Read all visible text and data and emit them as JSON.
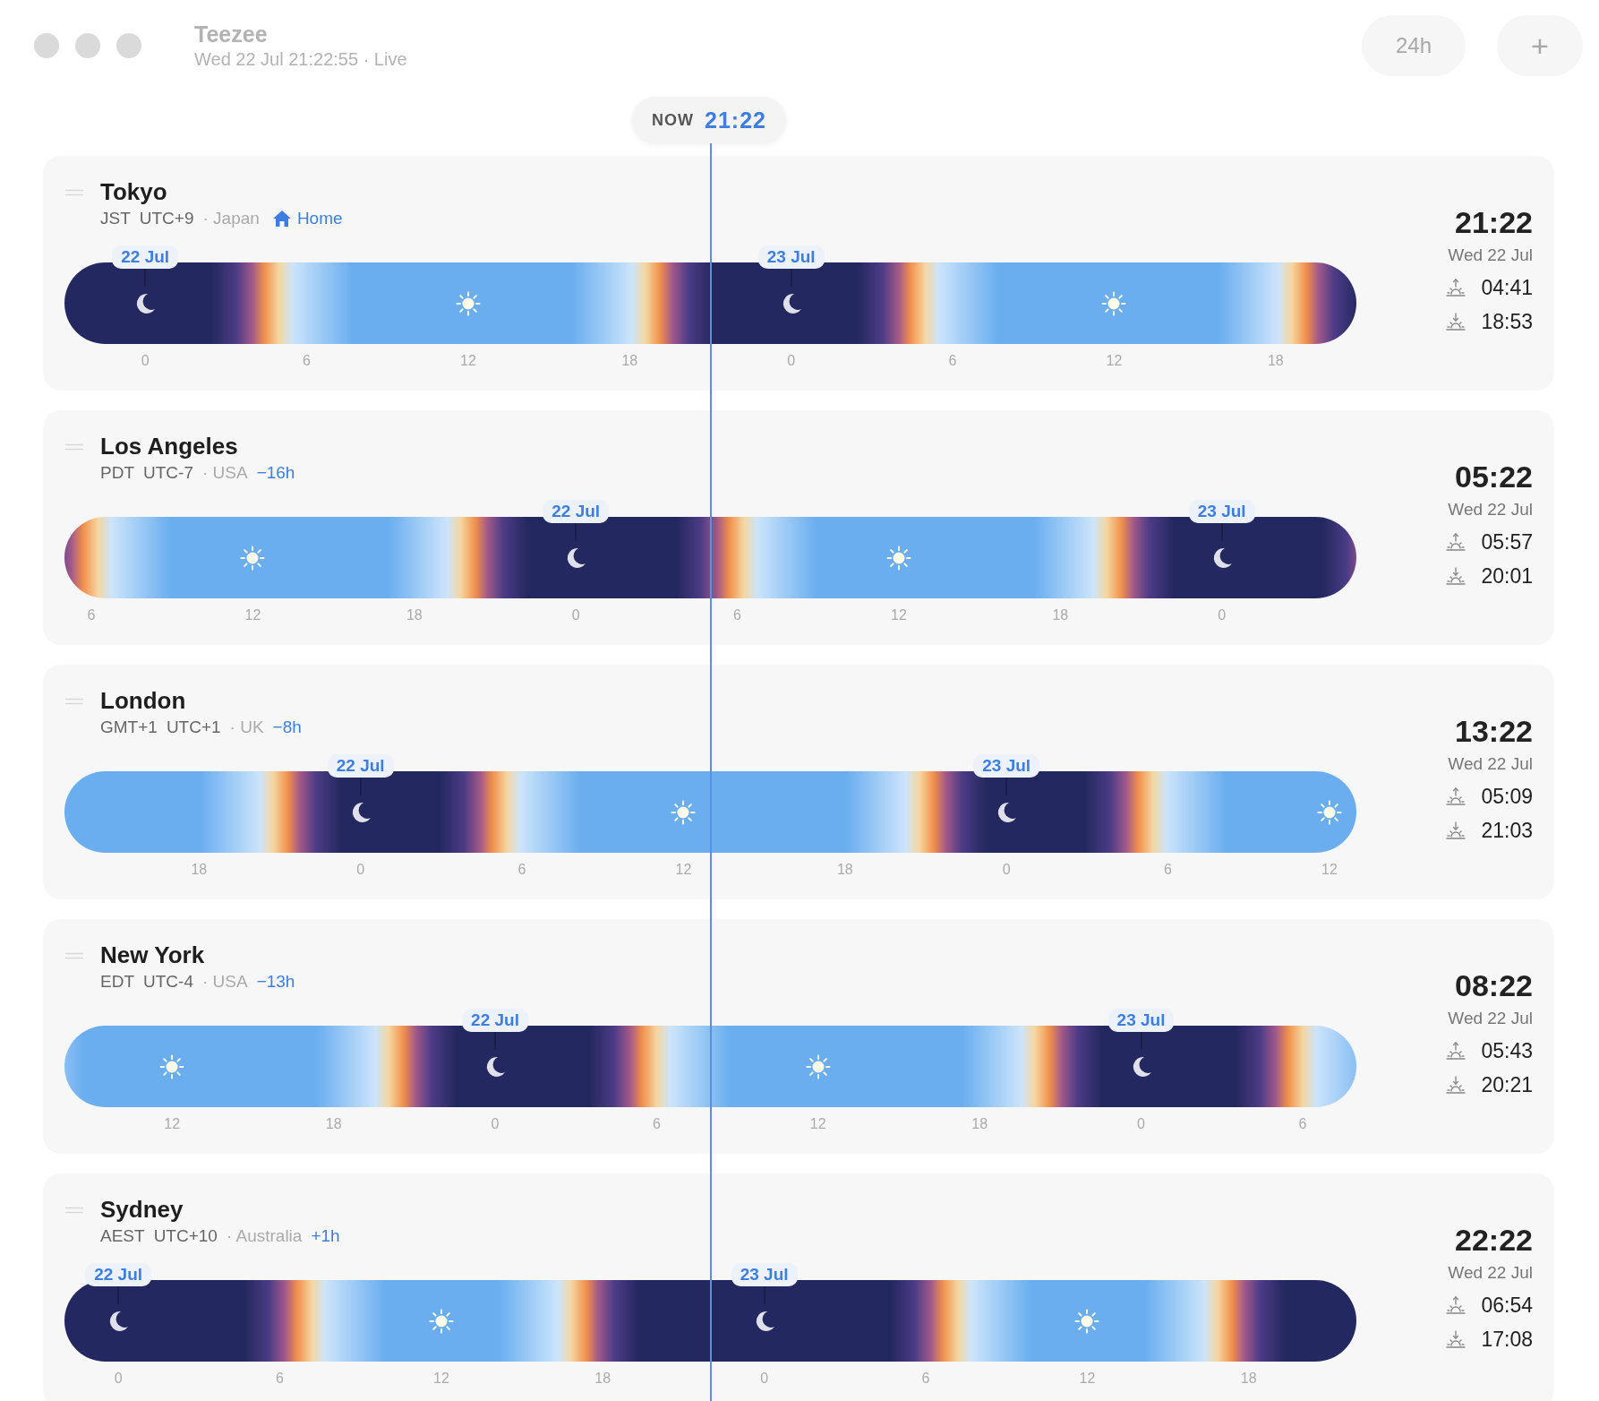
{
  "app": {
    "title": "Teezee",
    "subtitle": "Wed 22 Jul 21:22:55 · Live"
  },
  "toolbar": {
    "buttons": [
      "24h",
      "+"
    ]
  },
  "now_marker": {
    "label": "NOW",
    "time": "21:22"
  },
  "cities": [
    {
      "name": "Tokyo",
      "abbr": "JST",
      "utc": "UTC+9",
      "country": "· Japan",
      "badge": {
        "kind": "home",
        "text": "Home"
      },
      "time": "21:22",
      "date": "Wed 22 Jul",
      "sunrise": "04:41",
      "sunset": "18:53",
      "ticks": [
        {
          "label": "0",
          "kind": "midnight",
          "date": "22 Jul"
        },
        {
          "label": "6",
          "kind": "dawn"
        },
        {
          "label": "12",
          "kind": "noon"
        },
        {
          "label": "18",
          "kind": "dusk"
        },
        {
          "label": "0",
          "kind": "midnight",
          "date": "23 Jul"
        },
        {
          "label": "6",
          "kind": "dawn"
        },
        {
          "label": "12",
          "kind": "noon"
        },
        {
          "label": "18",
          "kind": "dusk"
        }
      ]
    },
    {
      "name": "Los Angeles",
      "abbr": "PDT",
      "utc": "UTC-7",
      "country": "· USA",
      "badge": {
        "kind": "offset",
        "text": "−16h"
      },
      "time": "05:22",
      "date": "Wed 22 Jul",
      "sunrise": "05:57",
      "sunset": "20:01",
      "ticks": [
        {
          "label": "6",
          "kind": "dawn"
        },
        {
          "label": "12",
          "kind": "noon"
        },
        {
          "label": "18",
          "kind": "dusk"
        },
        {
          "label": "0",
          "kind": "midnight",
          "date": "22 Jul"
        },
        {
          "label": "6",
          "kind": "dawn"
        },
        {
          "label": "12",
          "kind": "noon"
        },
        {
          "label": "18",
          "kind": "dusk"
        },
        {
          "label": "0",
          "kind": "midnight",
          "date": "23 Jul"
        }
      ]
    },
    {
      "name": "London",
      "abbr": "GMT+1",
      "utc": "UTC+1",
      "country": "· UK",
      "badge": {
        "kind": "offset",
        "text": "−8h"
      },
      "time": "13:22",
      "date": "Wed 22 Jul",
      "sunrise": "05:09",
      "sunset": "21:03",
      "ticks": [
        {
          "label": "18",
          "kind": "dusk"
        },
        {
          "label": "0",
          "kind": "midnight",
          "date": "22 Jul"
        },
        {
          "label": "6",
          "kind": "dawn"
        },
        {
          "label": "12",
          "kind": "noon"
        },
        {
          "label": "18",
          "kind": "dusk"
        },
        {
          "label": "0",
          "kind": "midnight",
          "date": "23 Jul"
        },
        {
          "label": "6",
          "kind": "dawn"
        },
        {
          "label": "12",
          "kind": "noon"
        }
      ]
    },
    {
      "name": "New York",
      "abbr": "EDT",
      "utc": "UTC-4",
      "country": "· USA",
      "badge": {
        "kind": "offset",
        "text": "−13h"
      },
      "time": "08:22",
      "date": "Wed 22 Jul",
      "sunrise": "05:43",
      "sunset": "20:21",
      "ticks": [
        {
          "label": "12",
          "kind": "noon"
        },
        {
          "label": "18",
          "kind": "dusk"
        },
        {
          "label": "0",
          "kind": "midnight",
          "date": "22 Jul"
        },
        {
          "label": "6",
          "kind": "dawn"
        },
        {
          "label": "12",
          "kind": "noon"
        },
        {
          "label": "18",
          "kind": "dusk"
        },
        {
          "label": "0",
          "kind": "midnight",
          "date": "23 Jul"
        },
        {
          "label": "6",
          "kind": "dawn"
        }
      ]
    },
    {
      "name": "Sydney",
      "abbr": "AEST",
      "utc": "UTC+10",
      "country": "· Australia",
      "badge": {
        "kind": "offset",
        "text": "+1h"
      },
      "time": "22:22",
      "date": "Wed 22 Jul",
      "sunrise": "06:54",
      "sunset": "17:08",
      "ticks": [
        {
          "label": "0",
          "kind": "midnight",
          "date": "22 Jul"
        },
        {
          "label": "6",
          "kind": "dawn"
        },
        {
          "label": "12",
          "kind": "noon"
        },
        {
          "label": "18",
          "kind": "dusk"
        },
        {
          "label": "0",
          "kind": "midnight",
          "date": "23 Jul"
        },
        {
          "label": "6",
          "kind": "dawn"
        },
        {
          "label": "12",
          "kind": "noon"
        },
        {
          "label": "18",
          "kind": "dusk"
        }
      ]
    }
  ]
}
